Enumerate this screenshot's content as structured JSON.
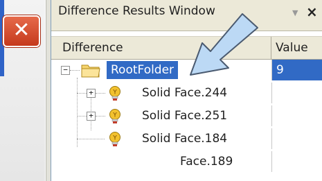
{
  "window": {
    "title": "Difference Results Window"
  },
  "columns": {
    "difference": "Difference",
    "value": "Value"
  },
  "tree": {
    "root": {
      "label": "RootFolder",
      "value": "9"
    },
    "items": [
      {
        "label": "Solid Face.244",
        "value": ""
      },
      {
        "label": "Solid Face.251",
        "value": ""
      },
      {
        "label": "Solid Face.184",
        "value": ""
      },
      {
        "label": "Face.189",
        "value": ""
      }
    ]
  },
  "icons": {
    "close": "close-icon",
    "folder": "folder-icon",
    "face": "lightbulb-icon",
    "expand": "plus-box-icon",
    "collapse": "minus-box-icon",
    "callout": "arrow-icon"
  },
  "colors": {
    "selection": "#316ac5",
    "title_bar": "#ece9d8",
    "close_button": "#d9512c",
    "arrow_fill": "#bcd9f5"
  }
}
